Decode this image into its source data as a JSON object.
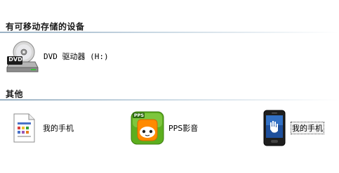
{
  "sections": {
    "removable_title": "有可移动存储的设备",
    "other_title": "其他"
  },
  "dvd_drive": {
    "label": "DVD 驱动器 (H:)",
    "badge": "DVD"
  },
  "items": [
    {
      "label": "我的手机",
      "icon": "document-file-icon"
    },
    {
      "label": "PPS影音",
      "icon": "pps-app-icon",
      "badge": "PPS"
    },
    {
      "label": "我的手机",
      "icon": "smartphone-icon"
    }
  ],
  "colors": {
    "section_line": "#9bb2c4",
    "pps_orange": "#ff8a00",
    "pps_green": "#5cae1e"
  }
}
